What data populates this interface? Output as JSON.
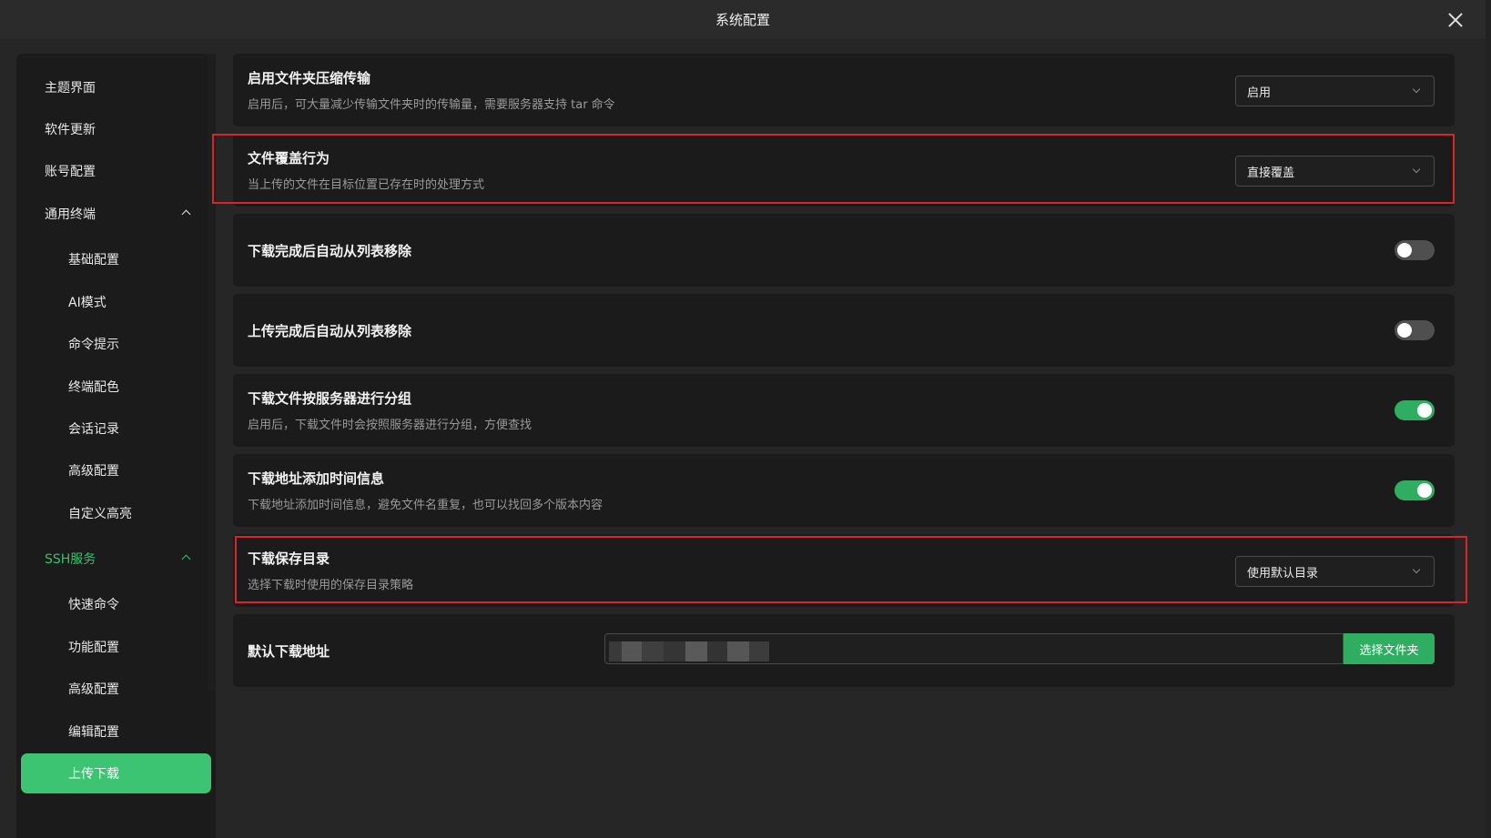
{
  "window": {
    "title": "系统配置"
  },
  "colors": {
    "accent": "#3cc472",
    "toggle_on": "#2fae62",
    "highlight_border": "#d8252b"
  },
  "sidebar": {
    "items": [
      {
        "label": "主题界面"
      },
      {
        "label": "软件更新"
      },
      {
        "label": "账号配置"
      },
      {
        "label": "通用终端",
        "expanded": true
      },
      {
        "label": "基础配置"
      },
      {
        "label": "AI模式"
      },
      {
        "label": "命令提示"
      },
      {
        "label": "终端配色"
      },
      {
        "label": "会话记录"
      },
      {
        "label": "高级配置"
      },
      {
        "label": "自定义高亮"
      },
      {
        "label": "SSH服务",
        "expanded": true
      },
      {
        "label": "快速命令"
      },
      {
        "label": "功能配置"
      },
      {
        "label": "高级配置"
      },
      {
        "label": "编辑配置"
      },
      {
        "label": "上传下载",
        "active": true
      }
    ]
  },
  "settings": {
    "compress": {
      "title": "启用文件夹压缩传输",
      "desc": "启用后，可大量减少传输文件夹时的传输量，需要服务器支持 tar 命令",
      "value": "启用"
    },
    "overwrite": {
      "title": "文件覆盖行为",
      "desc": "当上传的文件在目标位置已存在时的处理方式",
      "value": "直接覆盖"
    },
    "download_remove": {
      "title": "下载完成后自动从列表移除",
      "enabled": false
    },
    "upload_remove": {
      "title": "上传完成后自动从列表移除",
      "enabled": false
    },
    "group_by_server": {
      "title": "下载文件按服务器进行分组",
      "desc": "启用后，下载文件时会按照服务器进行分组，方便查找",
      "enabled": true
    },
    "add_time": {
      "title": "下载地址添加时间信息",
      "desc": "下载地址添加时间信息，避免文件名重复，也可以找回多个版本内容",
      "enabled": true
    },
    "save_dir": {
      "title": "下载保存目录",
      "desc": "选择下载时使用的保存目录策略",
      "value": "使用默认目录"
    },
    "default_path": {
      "title": "默认下载地址",
      "button": "选择文件夹"
    }
  }
}
